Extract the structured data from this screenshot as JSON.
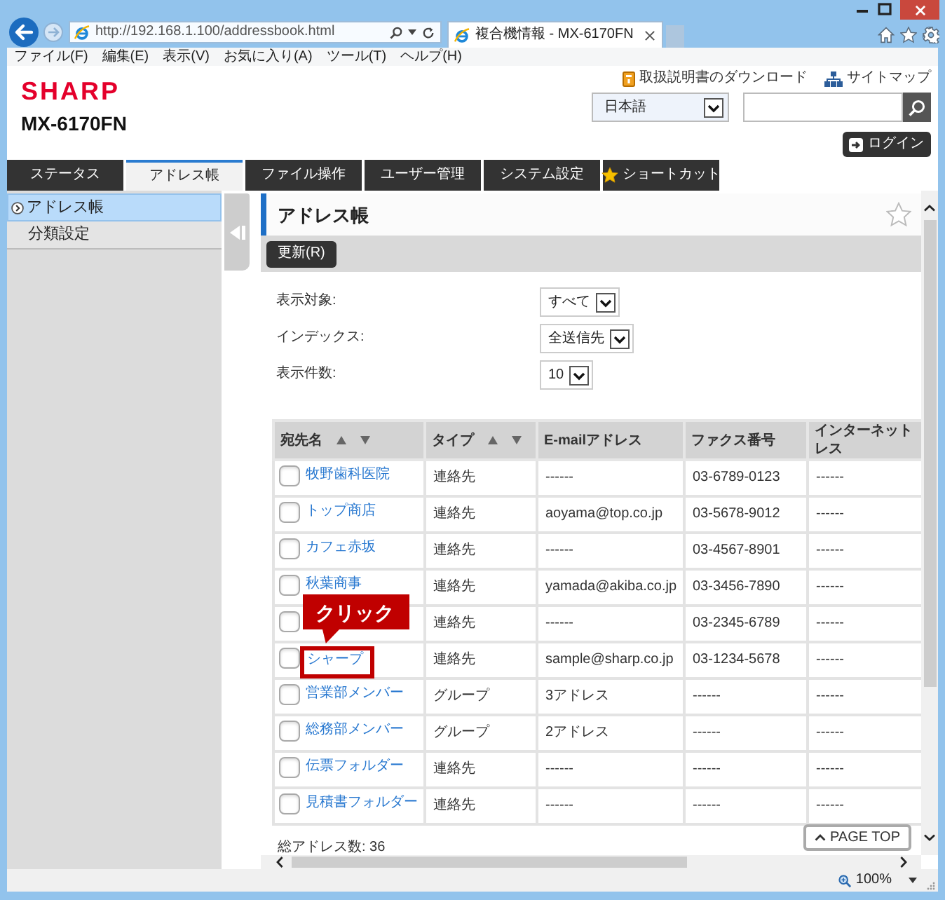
{
  "browser": {
    "url": "http://192.168.1.100/addressbook.html",
    "tab_title": "複合機情報 - MX-6170FN",
    "menu": [
      "ファイル(F)",
      "編集(E)",
      "表示(V)",
      "お気に入り(A)",
      "ツール(T)",
      "ヘルプ(H)"
    ]
  },
  "header": {
    "links": [
      {
        "label": "取扱説明書のダウンロード",
        "kind": "manual"
      },
      {
        "label": "サイトマップ",
        "kind": "sitemap"
      }
    ],
    "logo": "SHARP",
    "model": "MX-6170FN",
    "language": "日本語",
    "login": "ログイン"
  },
  "tabs": [
    {
      "label": "ステータス",
      "selected": false,
      "kind": "plain"
    },
    {
      "label": "アドレス帳",
      "selected": true,
      "kind": "plain"
    },
    {
      "label": "ファイル操作",
      "selected": false,
      "kind": "plain"
    },
    {
      "label": "ユーザー管理",
      "selected": false,
      "kind": "plain"
    },
    {
      "label": "システム設定",
      "selected": false,
      "kind": "plain"
    },
    {
      "label": "ショートカット",
      "selected": false,
      "kind": "star"
    }
  ],
  "sidebar": {
    "items": [
      {
        "label": "アドレス帳",
        "selected": true
      },
      {
        "label": "分類設定",
        "selected": false
      }
    ]
  },
  "page": {
    "title": "アドレス帳",
    "toolbar": [
      "更新(R)"
    ],
    "filters": [
      {
        "label": "表示対象:",
        "value": "すべて"
      },
      {
        "label": "インデックス:",
        "value": "全送信先"
      },
      {
        "label": "表示件数:",
        "value": "10"
      }
    ],
    "table": {
      "columns": [
        {
          "label": "宛先名",
          "sortable": true
        },
        {
          "label": "タイプ",
          "sortable": true
        },
        {
          "label": "E-mailアドレス",
          "sortable": false
        },
        {
          "label": "ファクス番号",
          "sortable": false
        },
        {
          "label": "インターネットレス",
          "sortable": false
        }
      ],
      "rows": [
        {
          "checked": false,
          "cells": [
            "牧野歯科医院",
            "連絡先",
            "------",
            "03-6789-0123",
            "------"
          ]
        },
        {
          "checked": false,
          "cells": [
            "トップ商店",
            "連絡先",
            "aoyama@top.co.jp",
            "03-5678-9012",
            "------"
          ]
        },
        {
          "checked": false,
          "cells": [
            "カフェ赤坂",
            "連絡先",
            "------",
            "03-4567-8901",
            "------"
          ]
        },
        {
          "checked": false,
          "cells": [
            "秋葉商事",
            "連絡先",
            "yamada@akiba.co.jp",
            "03-3456-7890",
            "------"
          ]
        },
        {
          "checked": false,
          "cells": [
            "",
            "連絡先",
            "------",
            "03-2345-6789",
            "------"
          ]
        },
        {
          "checked": false,
          "callout": "クリック",
          "cells": [
            "シャープ",
            "連絡先",
            "sample@sharp.co.jp",
            "03-1234-5678",
            "------"
          ]
        },
        {
          "checked": false,
          "cells": [
            "営業部メンバー",
            "グループ",
            "3アドレス",
            "------",
            "------"
          ]
        },
        {
          "checked": false,
          "cells": [
            "総務部メンバー",
            "グループ",
            "2アドレス",
            "------",
            "------"
          ]
        },
        {
          "checked": false,
          "cells": [
            "伝票フォルダー",
            "連絡先",
            "------",
            "------",
            "------"
          ]
        },
        {
          "checked": false,
          "cells": [
            "見積書フォルダー",
            "連絡先",
            "------",
            "------",
            "------"
          ]
        }
      ]
    },
    "total": "総アドレス数: 36",
    "page_top": "PAGE TOP"
  },
  "status_bar": {
    "zoom": "100%"
  }
}
